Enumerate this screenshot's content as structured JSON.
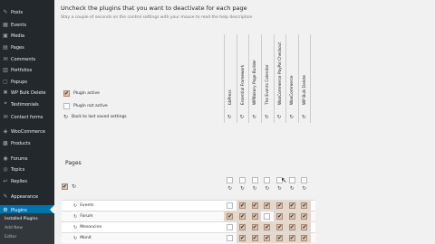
{
  "sidebar": {
    "items": [
      {
        "label": "Posts",
        "icon": "pin-icon"
      },
      {
        "label": "Events",
        "icon": "calendar-icon"
      },
      {
        "label": "Media",
        "icon": "media-icon"
      },
      {
        "label": "Pages",
        "icon": "page-icon"
      },
      {
        "label": "Comments",
        "icon": "comment-icon"
      },
      {
        "label": "Portfolios",
        "icon": "portfolio-icon"
      },
      {
        "label": "Popups",
        "icon": "popup-icon"
      },
      {
        "label": "WP Bulk Delete",
        "icon": "trash-icon"
      },
      {
        "label": "Testimonials",
        "icon": "quote-icon"
      },
      {
        "label": "Contact forms",
        "icon": "mail-icon"
      },
      {
        "label": "WooCommerce",
        "icon": "woo-icon"
      },
      {
        "label": "Products",
        "icon": "archive-icon"
      },
      {
        "label": "Forums",
        "icon": "forum-icon"
      },
      {
        "label": "Topics",
        "icon": "topic-icon"
      },
      {
        "label": "Replies",
        "icon": "reply-icon"
      },
      {
        "label": "Appearance",
        "icon": "brush-icon"
      },
      {
        "label": "Plugins",
        "icon": "plugin-icon"
      }
    ],
    "submenu": [
      "Installed Plugins",
      "Add New",
      "Editor"
    ]
  },
  "main": {
    "title": "Uncheck the plugins that you want to deactivate for each page",
    "description": "Stay a couple of seconds on the control settings with your mouse to read the help description",
    "legend": {
      "active": "Plugin active",
      "inactive": "Plugin not active",
      "back": "Back to last saved settings"
    },
    "columns": [
      "bbPress",
      "Essential Framework",
      "WPBakery Page Builder",
      "The Events Calendar",
      "WooCommerce PayPal Checkout",
      "WooCommerce",
      "WP Bulk Delete"
    ],
    "section_title": "Pages",
    "rows": [
      {
        "name": "Events",
        "cells": [
          false,
          true,
          true,
          true,
          true,
          true,
          true
        ]
      },
      {
        "name": "Forum",
        "cells": [
          true,
          true,
          true,
          false,
          true,
          true,
          true
        ]
      },
      {
        "name": "Mesoncine",
        "cells": [
          false,
          true,
          true,
          true,
          true,
          true,
          true
        ]
      },
      {
        "name": "Monit",
        "cells": [
          false,
          true,
          true,
          true,
          true,
          true,
          true
        ]
      }
    ]
  }
}
